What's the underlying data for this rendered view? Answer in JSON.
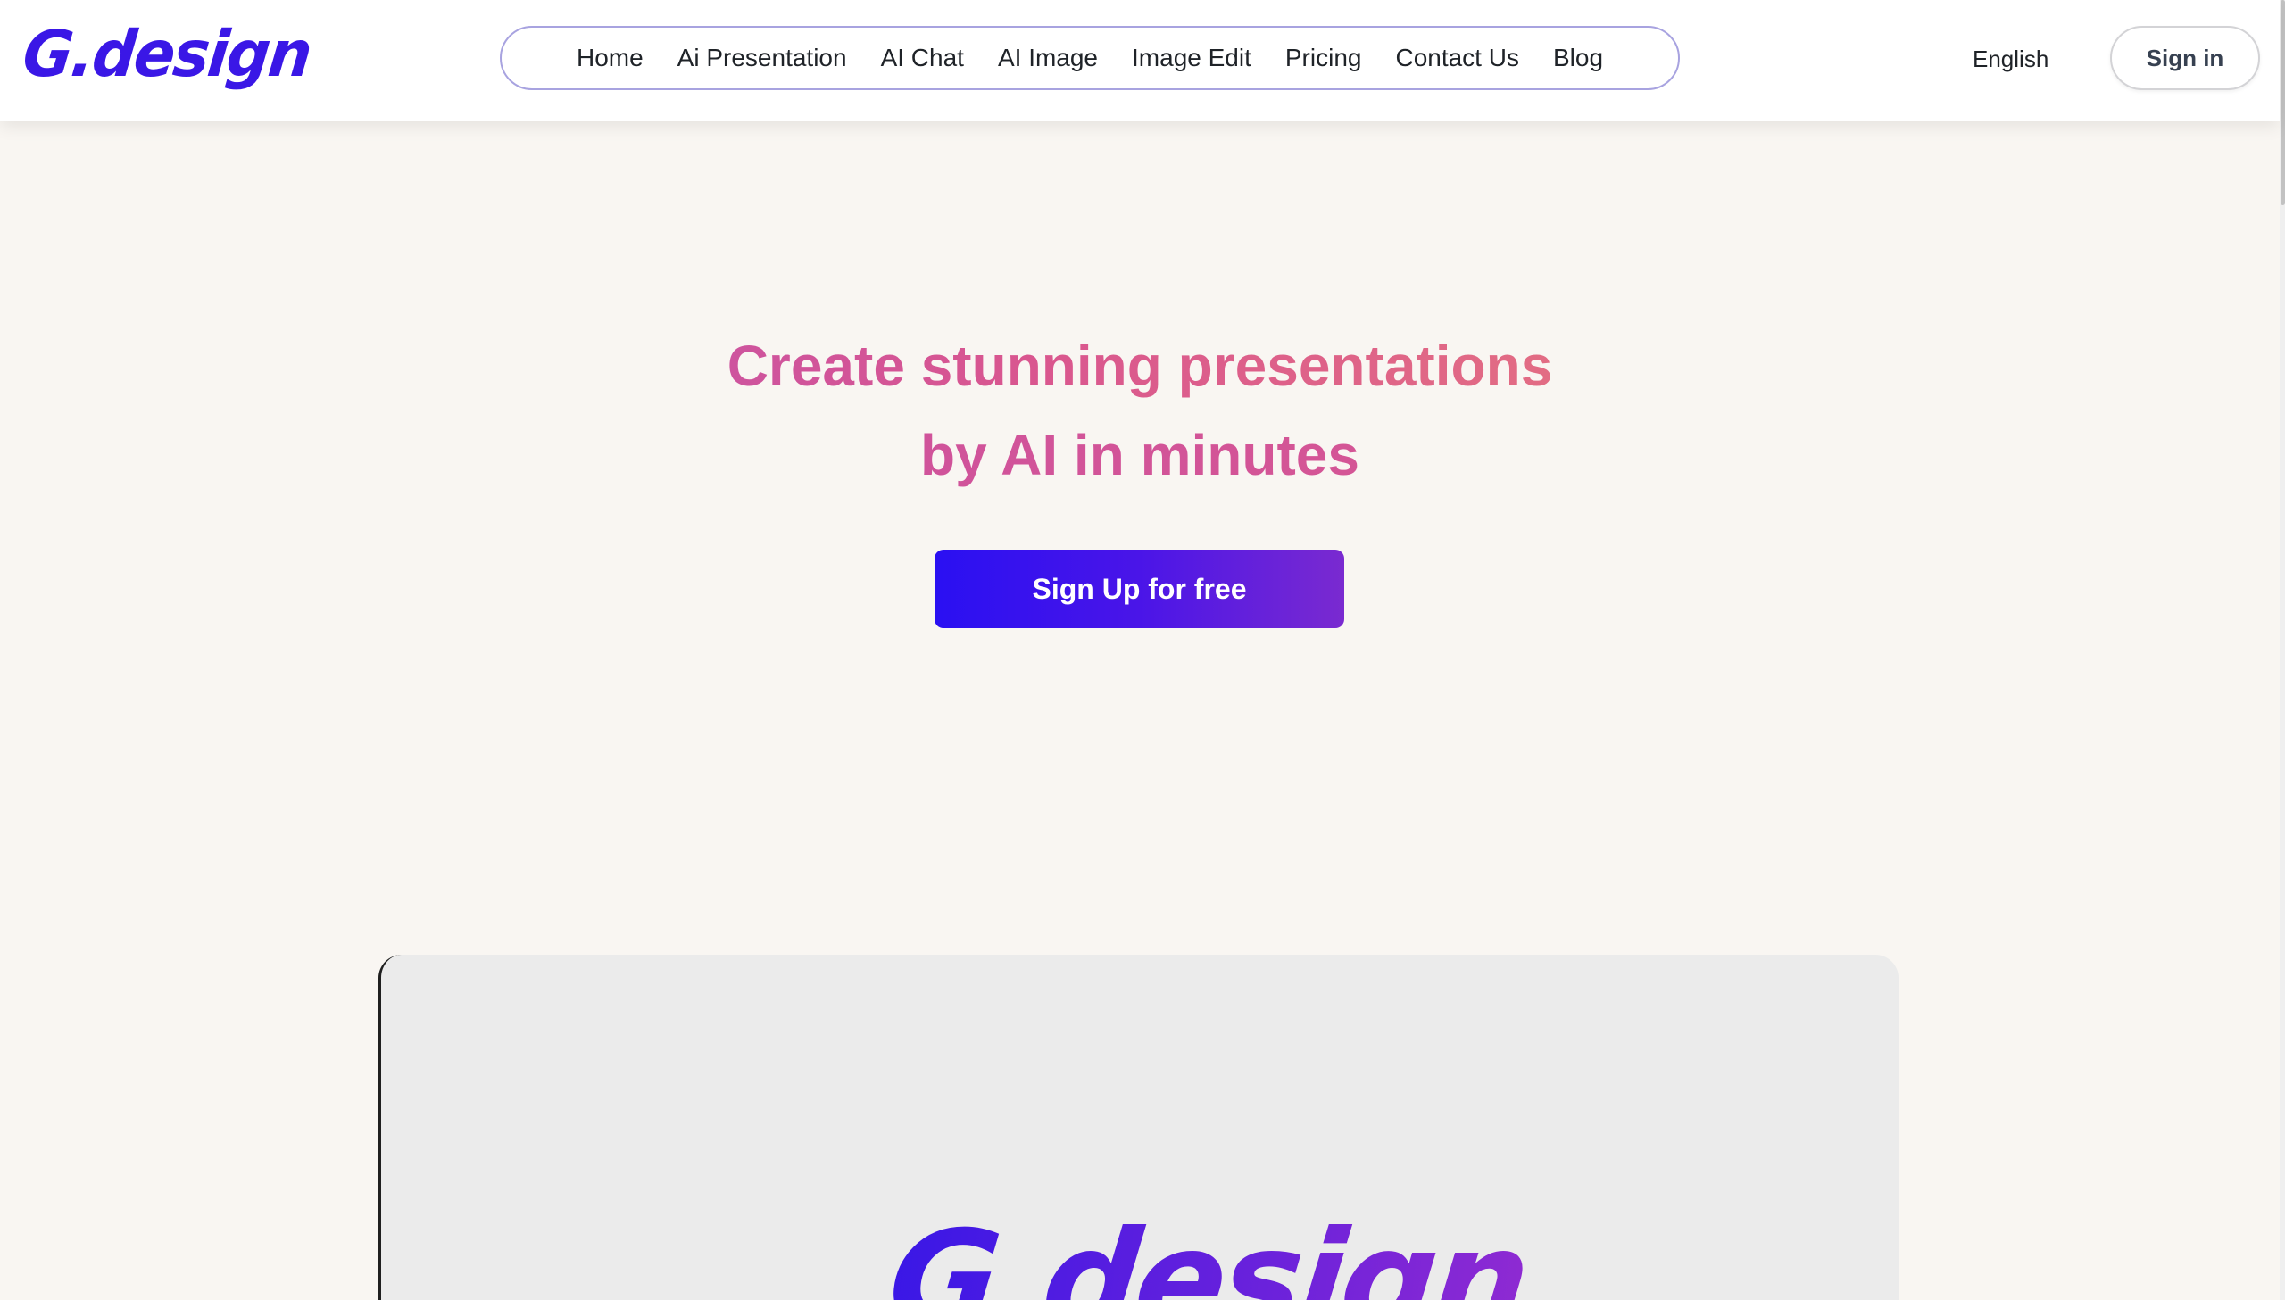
{
  "brand": {
    "logo_text": "G.design",
    "accent": "#3a17e6"
  },
  "nav": {
    "items": [
      {
        "label": "Home"
      },
      {
        "label": "Ai Presentation"
      },
      {
        "label": "AI Chat"
      },
      {
        "label": "AI Image"
      },
      {
        "label": "Image Edit"
      },
      {
        "label": "Pricing"
      },
      {
        "label": "Contact Us"
      },
      {
        "label": "Blog"
      }
    ]
  },
  "header": {
    "language": "English",
    "signin_label": "Sign in"
  },
  "hero": {
    "headline_line1": "Create stunning presentations",
    "headline_line2": "by AI in minutes",
    "cta_label": "Sign Up for free"
  },
  "preview": {
    "logo_text": "G.design"
  }
}
